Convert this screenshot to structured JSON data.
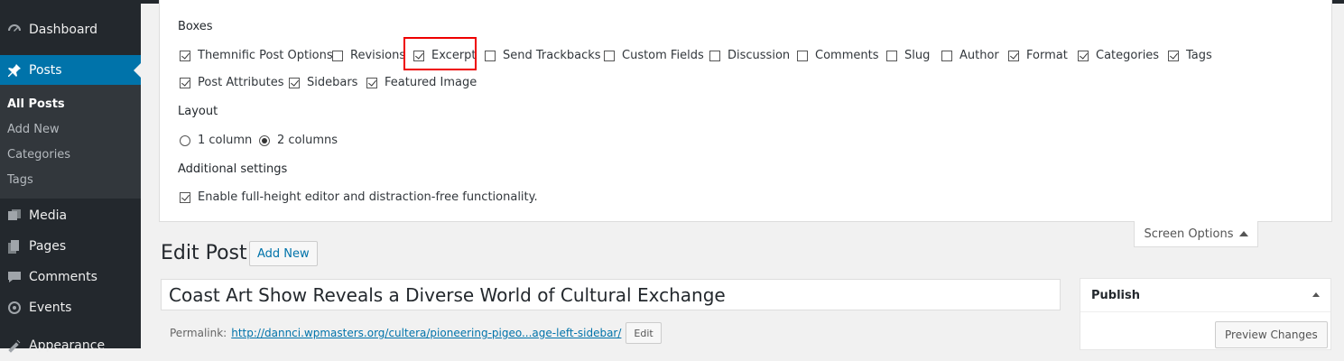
{
  "sidebar": {
    "items": [
      {
        "label": "Dashboard",
        "icon": "dashboard-icon"
      },
      {
        "label": "Posts",
        "icon": "pin-icon"
      },
      {
        "label": "Media",
        "icon": "media-icon"
      },
      {
        "label": "Pages",
        "icon": "pages-icon"
      },
      {
        "label": "Comments",
        "icon": "comments-icon"
      },
      {
        "label": "Events",
        "icon": "events-icon"
      },
      {
        "label": "Appearance",
        "icon": "appearance-icon"
      }
    ],
    "submenu": [
      "All Posts",
      "Add New",
      "Categories",
      "Tags"
    ]
  },
  "screen_options": {
    "boxes_title": "Boxes",
    "boxes": [
      {
        "label": "Themnific Post Options",
        "checked": true
      },
      {
        "label": "Revisions",
        "checked": false
      },
      {
        "label": "Excerpt",
        "checked": true
      },
      {
        "label": "Send Trackbacks",
        "checked": false
      },
      {
        "label": "Custom Fields",
        "checked": false
      },
      {
        "label": "Discussion",
        "checked": false
      },
      {
        "label": "Comments",
        "checked": false
      },
      {
        "label": "Slug",
        "checked": false
      },
      {
        "label": "Author",
        "checked": false
      },
      {
        "label": "Format",
        "checked": true
      },
      {
        "label": "Categories",
        "checked": true
      },
      {
        "label": "Tags",
        "checked": true
      },
      {
        "label": "Post Attributes",
        "checked": true
      },
      {
        "label": "Sidebars",
        "checked": true
      },
      {
        "label": "Featured Image",
        "checked": true
      }
    ],
    "layout_title": "Layout",
    "layout": [
      {
        "label": "1 column",
        "checked": false
      },
      {
        "label": "2 columns",
        "checked": true
      }
    ],
    "additional_title": "Additional settings",
    "additional": [
      {
        "label": "Enable full-height editor and distraction-free functionality.",
        "checked": true
      }
    ],
    "tab_label": "Screen Options"
  },
  "edit": {
    "page_title": "Edit Post",
    "add_new": "Add New",
    "post_title": "Coast Art Show Reveals a Diverse World of Cultural Exchange",
    "permalink_label": "Permalink:",
    "permalink_url": "http://dannci.wpmasters.org/cultera/pioneering-pigeo...age-left-sidebar/",
    "edit_label": "Edit"
  },
  "publish": {
    "title": "Publish",
    "preview_label": "Preview Changes"
  },
  "colors": {
    "sidebar_bg": "#23282d",
    "accent": "#0073aa",
    "highlight": "#e00000"
  }
}
